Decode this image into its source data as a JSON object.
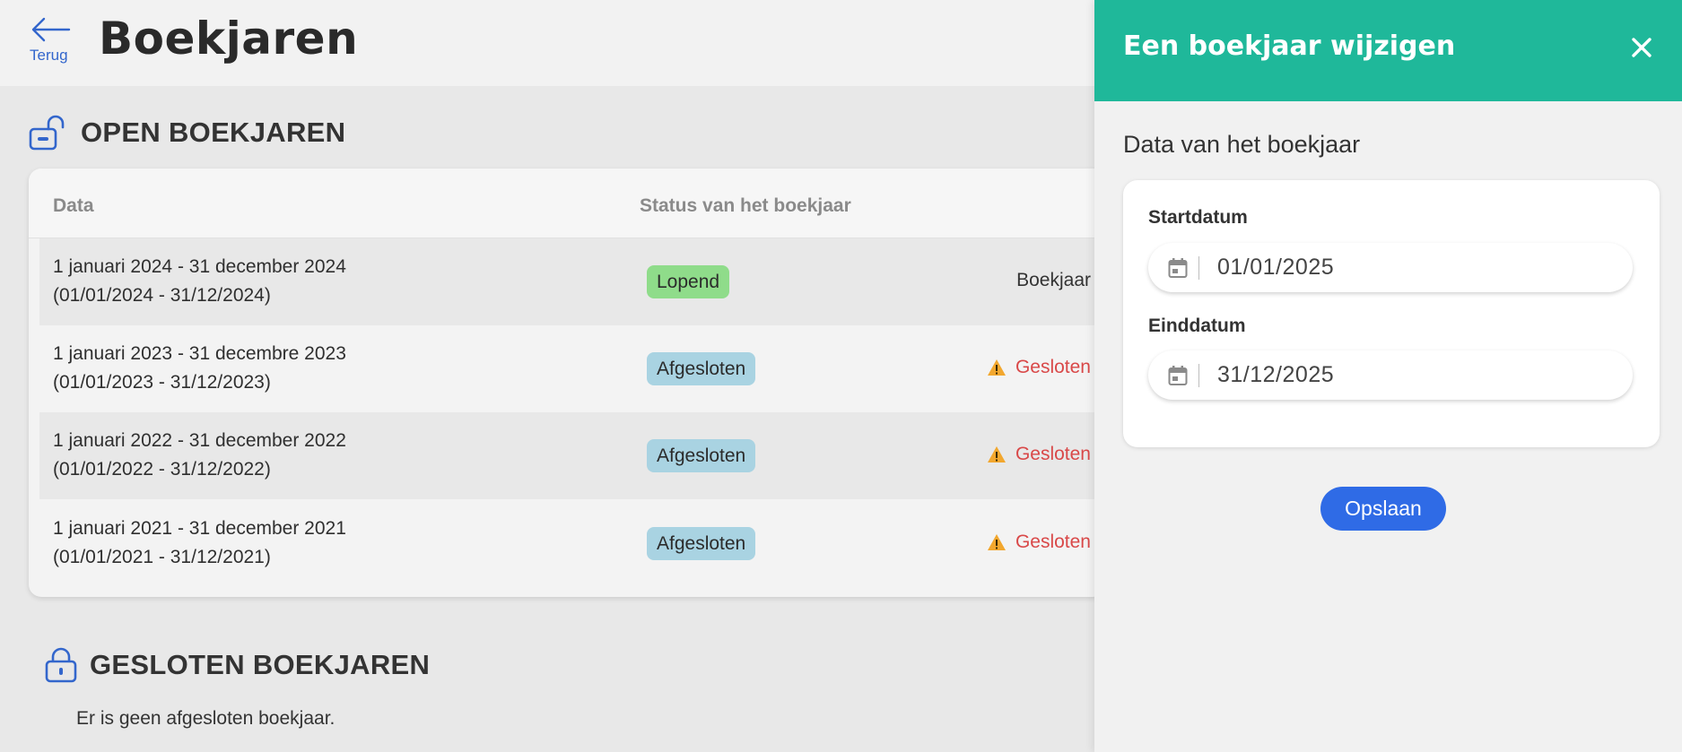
{
  "header": {
    "back_label": "Terug",
    "title": "Boekjaren"
  },
  "open_section": {
    "title": "OPEN BOEKJAREN",
    "columns": [
      "Data",
      "Status van het boekjaar"
    ],
    "rows": [
      {
        "line1": "1 januari 2024 - 31 december 2024",
        "line2": "(01/01/2024 - 31/12/2024)",
        "status": "Lopend",
        "action": "Boekjaar"
      },
      {
        "line1": "1 januari 2023 - 31 decembre 2023",
        "line2": "(01/01/2023 - 31/12/2023)",
        "status": "Afgesloten",
        "action": "Gesloten"
      },
      {
        "line1": "1 januari 2022 - 31 december 2022",
        "line2": "(01/01/2022 - 31/12/2022)",
        "status": "Afgesloten",
        "action": "Gesloten"
      },
      {
        "line1": "1 januari 2021 - 31 december 2021",
        "line2": "(01/01/2021 - 31/12/2021)",
        "status": "Afgesloten",
        "action": "Gesloten"
      }
    ]
  },
  "closed_section": {
    "title": "GESLOTEN BOEKJAREN",
    "empty_message": "Er is geen afgesloten boekjaar."
  },
  "panel": {
    "title": "Een boekjaar wijzigen",
    "subtitle": "Data van het boekjaar",
    "start_label": "Startdatum",
    "start_value": "01/01/2025",
    "end_label": "Einddatum",
    "end_value": "31/12/2025",
    "save_label": "Opslaan"
  },
  "colors": {
    "panel_header": "#1fb89a",
    "primary_button": "#2f6be6",
    "badge_running": "#8fdc8a",
    "badge_closed": "#a9d3e2",
    "closed_text": "#d94848",
    "icon_blue": "#3366cc"
  },
  "icons": {
    "back": "arrow-left-icon",
    "open_section": "unlocked-padlock-icon",
    "closed_section": "locked-padlock-icon",
    "warning": "warning-triangle-icon",
    "calendar": "calendar-icon",
    "close": "close-icon"
  }
}
